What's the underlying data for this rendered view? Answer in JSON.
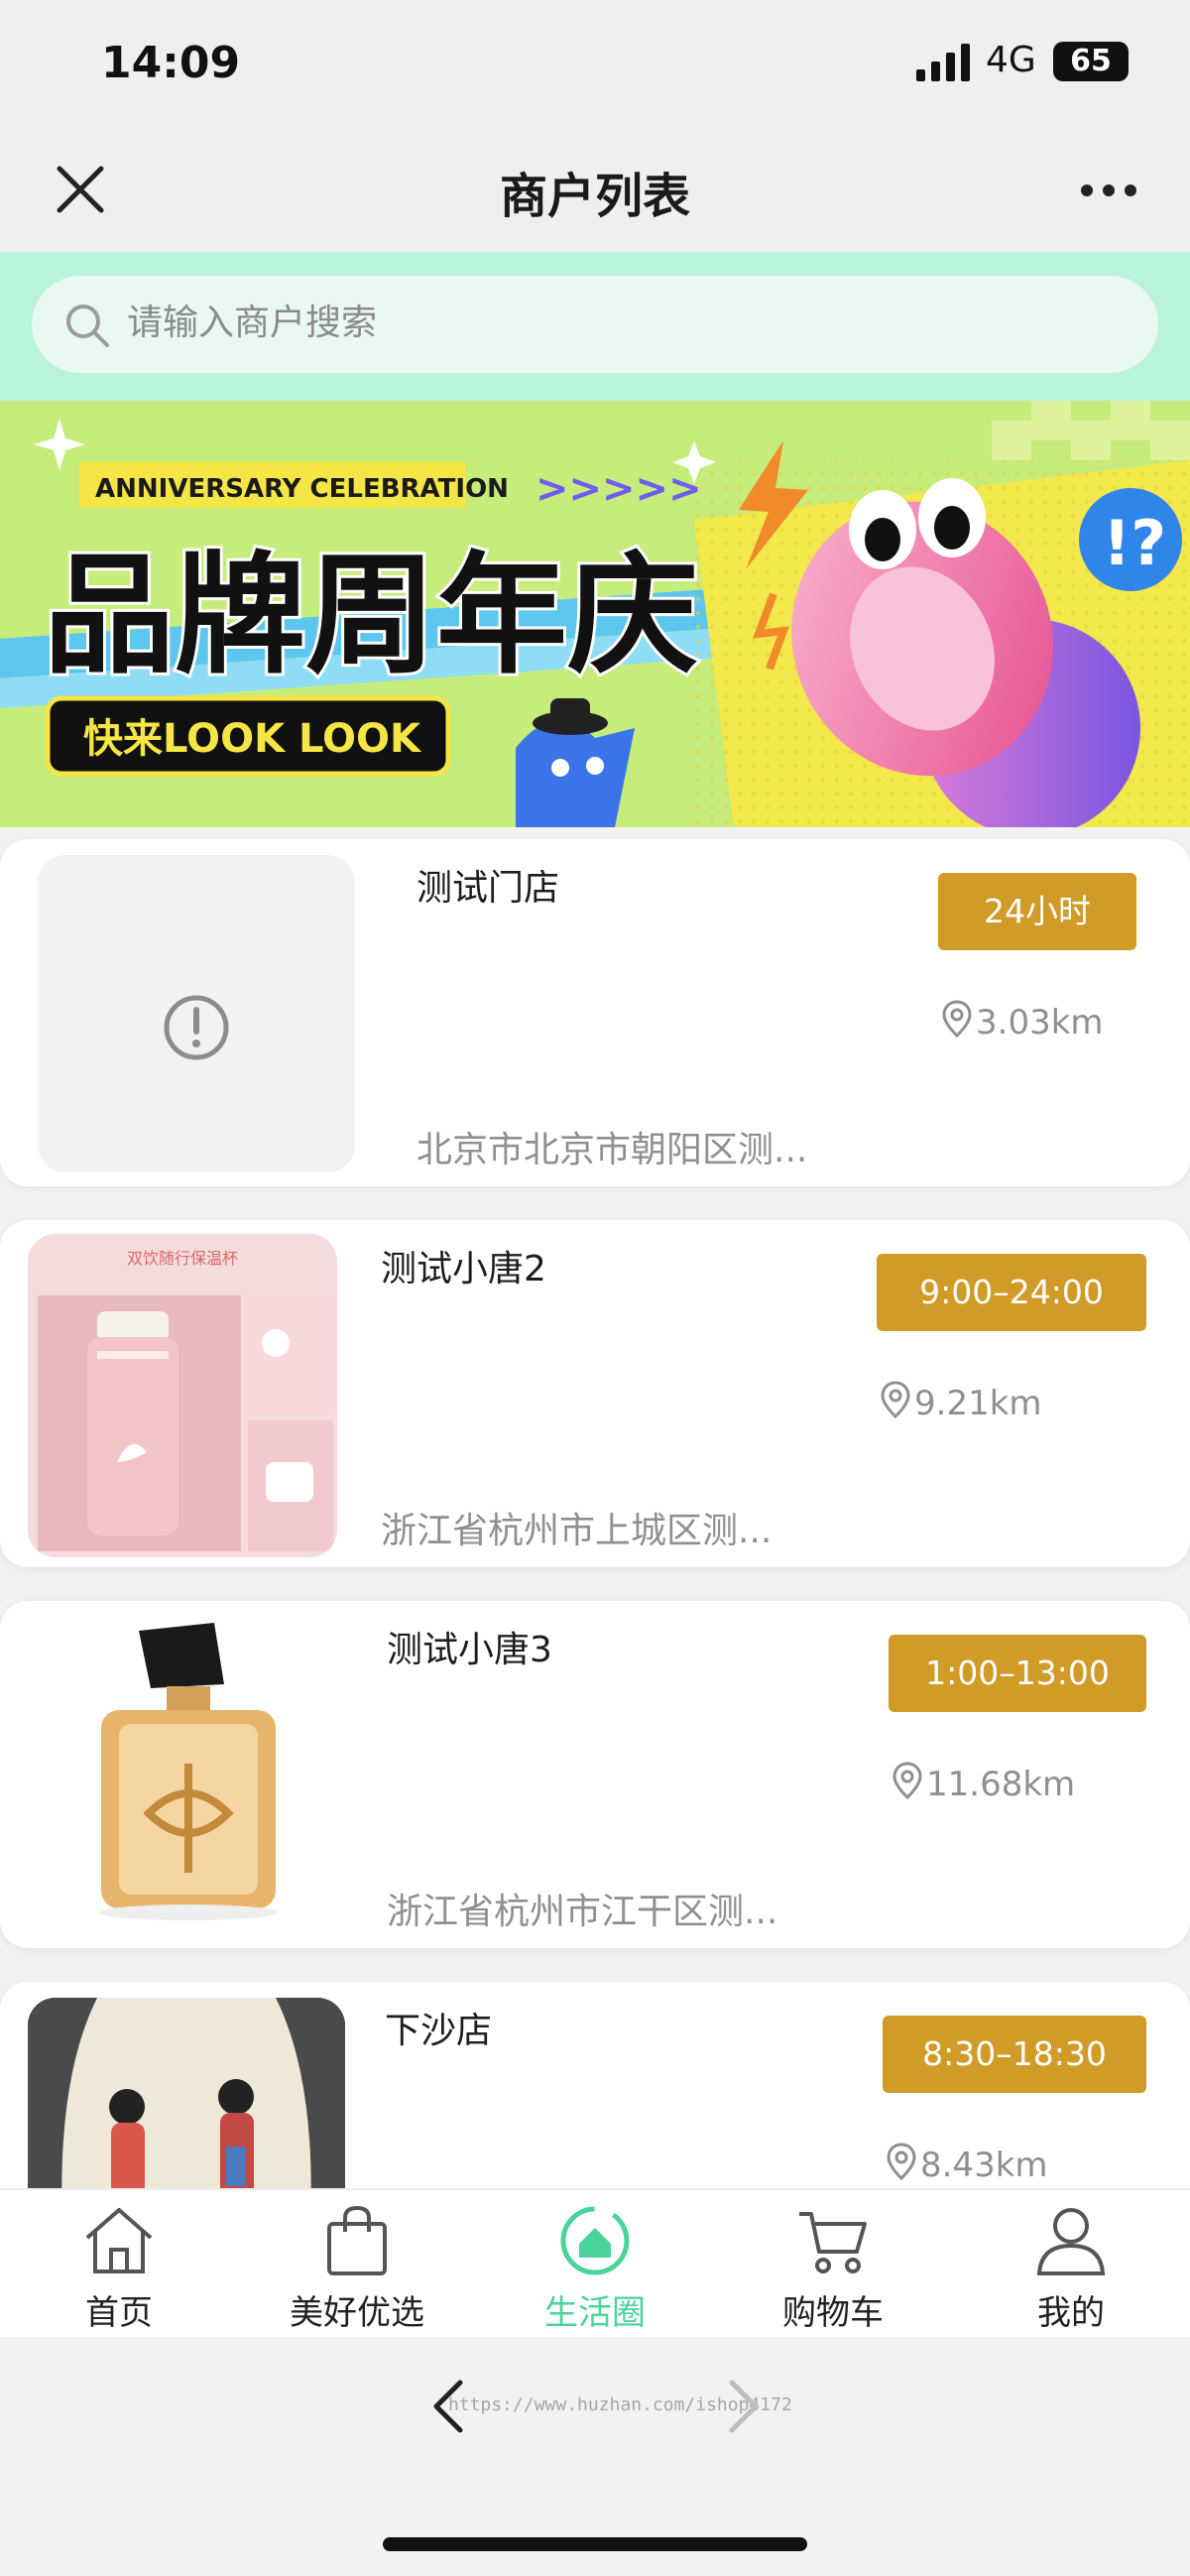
{
  "status_bar": {
    "time": "14:09",
    "network": "4G",
    "battery": "65"
  },
  "nav": {
    "title": "商户列表"
  },
  "search": {
    "placeholder": "请输入商户搜索"
  },
  "banner": {
    "tag": "ANNIVERSARY CELEBRATION",
    "headline": "品牌周年庆",
    "sub": "快来LOOK LOOK",
    "arrows": ">>>>>"
  },
  "stores": [
    {
      "name": "测试门店",
      "hours": "24小时",
      "distance": "3.03km",
      "address": "北京市北京市朝阳区测...",
      "image": "placeholder-alert-icon"
    },
    {
      "name": "测试小唐2",
      "hours": "9:00–24:00",
      "distance": "9.21km",
      "address": "浙江省杭州市上城区测...",
      "image": "pink-thermos-cup",
      "image_text": "双饮随行保温杯"
    },
    {
      "name": "测试小唐3",
      "hours": "1:00–13:00",
      "distance": "11.68km",
      "address": "浙江省杭州市江干区测...",
      "image": "perfume-bottle"
    },
    {
      "name": "下沙店",
      "hours": "8:30–18:30",
      "distance": "8.43km",
      "address": "",
      "image": "porcelain-vase"
    }
  ],
  "tabs": [
    {
      "label": "首页",
      "icon": "home-icon",
      "active": false
    },
    {
      "label": "美好优选",
      "icon": "shopping-bag-icon",
      "active": false
    },
    {
      "label": "生活圈",
      "icon": "life-circle-icon",
      "active": true
    },
    {
      "label": "购物车",
      "icon": "cart-icon",
      "active": false
    },
    {
      "label": "我的",
      "icon": "user-icon",
      "active": false
    }
  ],
  "browser": {
    "url": "https://www.huzhan.com/ishop4172"
  },
  "colors": {
    "accent": "#4ad39a",
    "hours_badge": "#d09b27",
    "search_band": "#b9f3dc"
  }
}
